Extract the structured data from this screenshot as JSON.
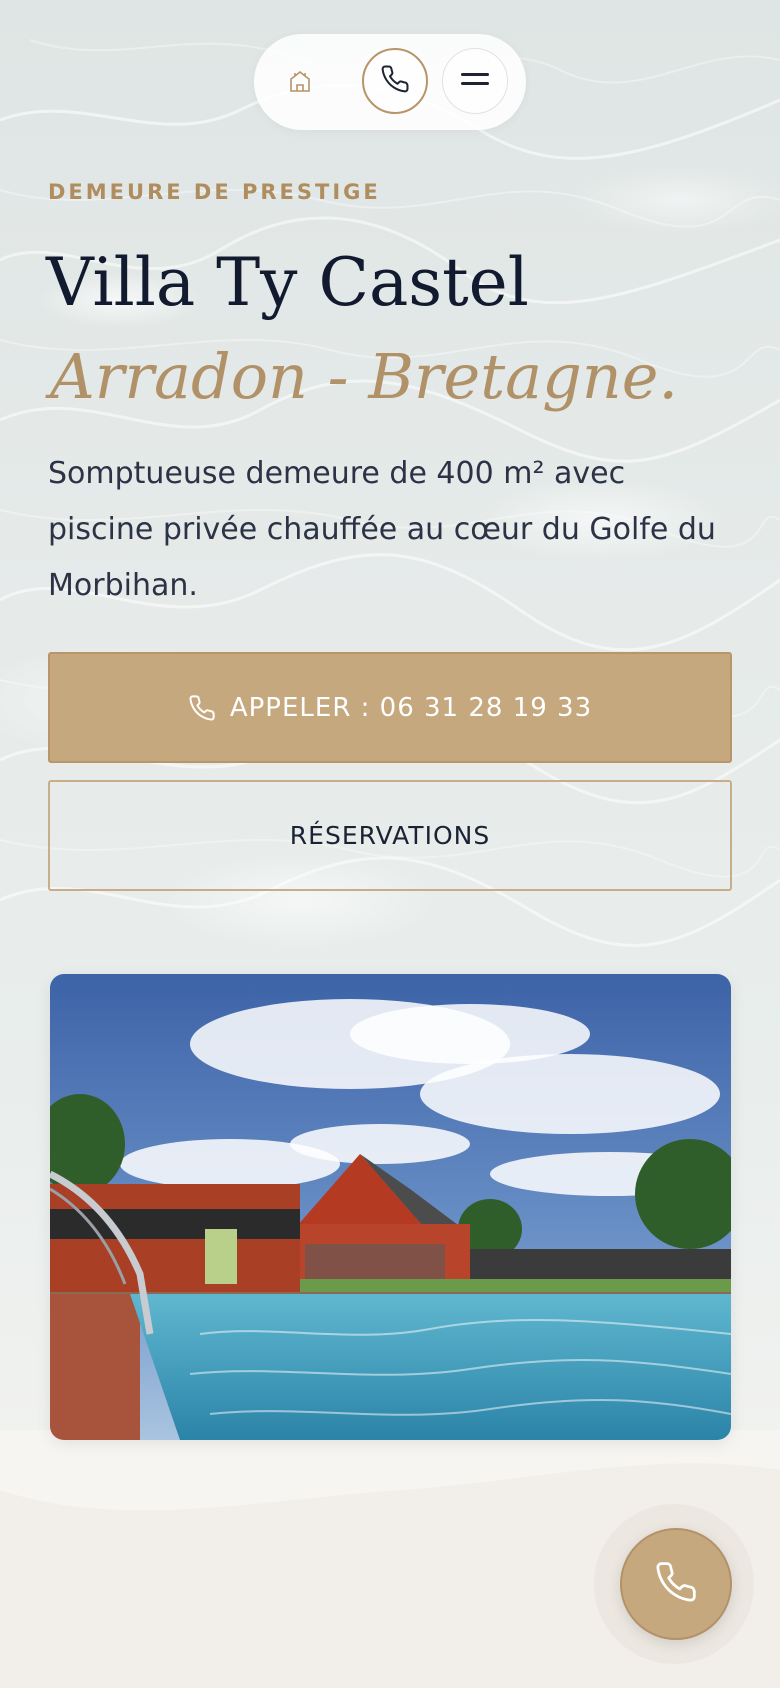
{
  "header": {
    "logo_icon": "castle-icon",
    "phone_icon": "phone-icon",
    "menu_icon": "menu-icon"
  },
  "hero": {
    "eyebrow": "DEMEURE DE PRESTIGE",
    "title": "Villa Ty Castel",
    "subtitle": "Arradon - Bretagne.",
    "description": "Somptueuse demeure de 400 m² avec piscine privée chauffée au cœur du Golfe du Morbihan."
  },
  "actions": {
    "call_label": "APPELER : 06 31 28 19 33",
    "call_icon": "phone-icon",
    "reserve_label": "RÉSERVATIONS"
  },
  "photo": {
    "subject": "villa-with-pool-photo"
  },
  "fab": {
    "icon": "phone-icon"
  },
  "colors": {
    "accent": "#c6a87f",
    "accent_text": "#b08d5e",
    "title": "#111a2e",
    "body_text": "#2c3346"
  }
}
